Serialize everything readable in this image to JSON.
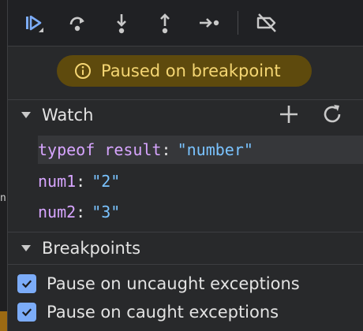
{
  "left_fragment": "n",
  "toolbar": {
    "buttons": [
      {
        "name": "resume-icon",
        "tooltip": "Resume script execution"
      },
      {
        "name": "step-over-icon",
        "tooltip": "Step over next function call"
      },
      {
        "name": "step-into-icon",
        "tooltip": "Step into next function call"
      },
      {
        "name": "step-out-icon",
        "tooltip": "Step out of current function"
      },
      {
        "name": "step-icon",
        "tooltip": "Step"
      },
      {
        "name": "deactivate-breakpoints-icon",
        "tooltip": "Deactivate breakpoints"
      }
    ]
  },
  "paused": {
    "message": "Paused on breakpoint"
  },
  "watch": {
    "title": "Watch",
    "items": [
      {
        "expr": "typeof result",
        "value": "\"number\""
      },
      {
        "expr": "num1",
        "value": "\"2\""
      },
      {
        "expr": "num2",
        "value": "\"3\""
      }
    ]
  },
  "breakpoints": {
    "title": "Breakpoints",
    "options": [
      {
        "label": "Pause on uncaught exceptions",
        "checked": true
      },
      {
        "label": "Pause on caught exceptions",
        "checked": true
      }
    ]
  },
  "colors": {
    "accent": "#7cacf8",
    "paused_bg": "#5e4a0d",
    "paused_text": "#f5d673",
    "expr": "#d7a5ff",
    "string_value": "#7ac3ff"
  }
}
